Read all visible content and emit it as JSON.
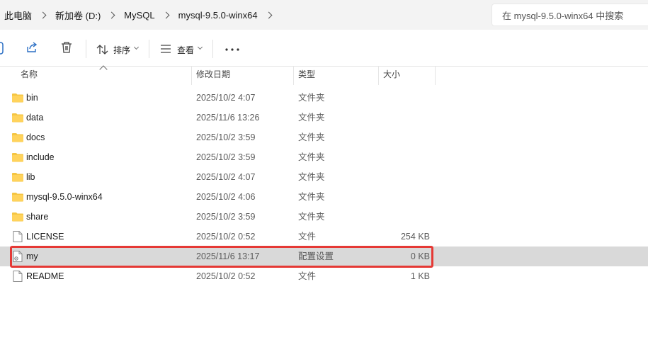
{
  "breadcrumb": {
    "items": [
      "此电脑",
      "新加卷 (D:)",
      "MySQL",
      "mysql-9.5.0-winx64"
    ]
  },
  "search": {
    "placeholder": "在 mysql-9.5.0-winx64 中搜索"
  },
  "toolbar": {
    "sort_label": "排序",
    "view_label": "查看",
    "more_label": "···",
    "icons": [
      "copy-icon",
      "share-icon",
      "delete-icon",
      "sort-icon",
      "view-icon",
      "more-icon"
    ]
  },
  "columns": {
    "name": "名称",
    "date": "修改日期",
    "type": "类型",
    "size": "大小"
  },
  "files": [
    {
      "name": "bin",
      "date": "2025/10/2 4:07",
      "type": "文件夹",
      "size": "",
      "kind": "folder",
      "selected": false
    },
    {
      "name": "data",
      "date": "2025/11/6 13:26",
      "type": "文件夹",
      "size": "",
      "kind": "folder",
      "selected": false
    },
    {
      "name": "docs",
      "date": "2025/10/2 3:59",
      "type": "文件夹",
      "size": "",
      "kind": "folder",
      "selected": false
    },
    {
      "name": "include",
      "date": "2025/10/2 3:59",
      "type": "文件夹",
      "size": "",
      "kind": "folder",
      "selected": false
    },
    {
      "name": "lib",
      "date": "2025/10/2 4:07",
      "type": "文件夹",
      "size": "",
      "kind": "folder",
      "selected": false
    },
    {
      "name": "mysql-9.5.0-winx64",
      "date": "2025/10/2 4:06",
      "type": "文件夹",
      "size": "",
      "kind": "folder",
      "selected": false
    },
    {
      "name": "share",
      "date": "2025/10/2 3:59",
      "type": "文件夹",
      "size": "",
      "kind": "folder",
      "selected": false
    },
    {
      "name": "LICENSE",
      "date": "2025/10/2 0:52",
      "type": "文件",
      "size": "254 KB",
      "kind": "file",
      "selected": false
    },
    {
      "name": "my",
      "date": "2025/11/6 13:17",
      "type": "配置设置",
      "size": "0 KB",
      "kind": "config",
      "selected": true
    },
    {
      "name": "README",
      "date": "2025/10/2 0:52",
      "type": "文件",
      "size": "1 KB",
      "kind": "file",
      "selected": false
    }
  ],
  "colors": {
    "folder": "#f5c542",
    "selection": "#d9d9d9",
    "highlight_box": "#e53935"
  }
}
